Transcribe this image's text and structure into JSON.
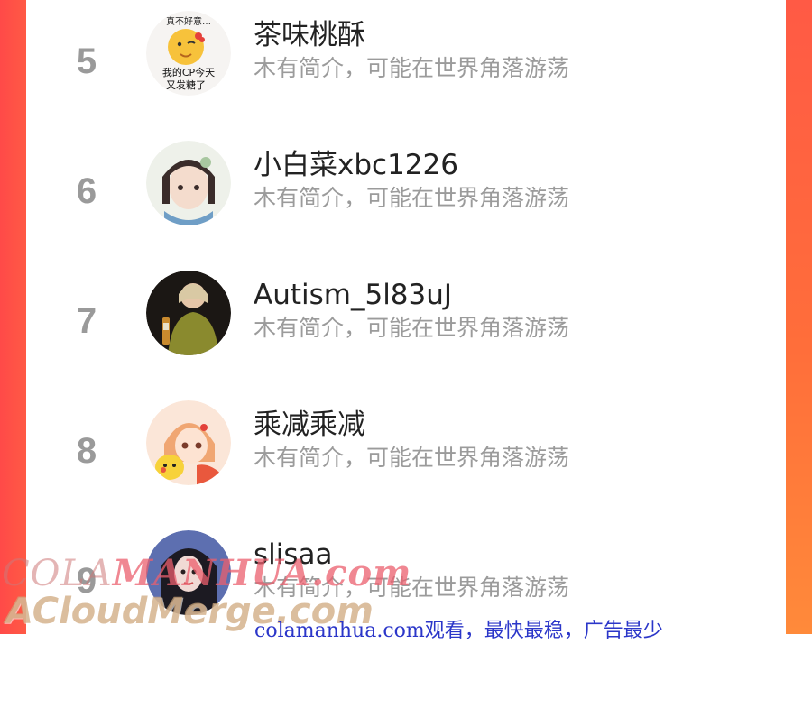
{
  "leaderboard": {
    "rows": [
      {
        "rank": "5",
        "name": "茶味桃酥",
        "bio": "木有简介，可能在世界角落游荡",
        "avatar_icon": "emoji-sticker-avatar",
        "avatar_text": [
          "真不好意…",
          "我的CP今天",
          "又发糖了"
        ]
      },
      {
        "rank": "6",
        "name": "小白菜xbc1226",
        "bio": "木有简介，可能在世界角落游荡",
        "avatar_icon": "anime-girl-avatar"
      },
      {
        "rank": "7",
        "name": "Autism_5l83uJ",
        "bio": "木有简介，可能在世界角落游荡",
        "avatar_icon": "photo-person-avatar"
      },
      {
        "rank": "8",
        "name": "乘减乘减",
        "bio": "木有简介，可能在世界角落游荡",
        "avatar_icon": "anime-pikachu-avatar"
      },
      {
        "rank": "9",
        "name": "slisaa",
        "bio": "木有简介，可能在世界角落游荡",
        "avatar_icon": "dark-hair-girl-avatar"
      }
    ]
  },
  "watermarks": {
    "line1_a": "COLA",
    "line1_b": "MANHUA.com",
    "line2": "ACloudMerge.com"
  },
  "footer_note": "colamanhua.com观看，最快最稳，广告最少",
  "colors": {
    "frame": "#ff6e3a",
    "rank_number": "#9a9a9a",
    "username": "#222222",
    "bio": "#9b9b9b",
    "note_link": "#2b36c9"
  }
}
